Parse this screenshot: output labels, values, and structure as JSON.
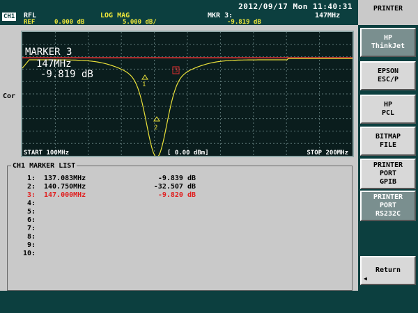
{
  "header": {
    "datetime": "2012/09/17 Mon 11:40:31",
    "channel": "CH1",
    "format": "RFL",
    "ref_label": "REF",
    "ref_value": "0.000 dB",
    "scale_type": "LOG MAG",
    "scale_value": "5.000 dB/",
    "marker_label": "MKR 3:",
    "marker_freq": "147MHz",
    "marker_value": "-9.819 dB",
    "cor": "Cor"
  },
  "plot": {
    "marker_title": "MARKER 3",
    "marker_freq": "147MHz",
    "marker_value": "-9.819 dB",
    "start_label": "START 100MHz",
    "ref_line_label": "[ 0.00 dBm]",
    "stop_label": "STOP 200MHz",
    "trace_color": "#e9e13a",
    "ref_color": "#e03030",
    "marker_labels": [
      "1",
      "2",
      "3"
    ]
  },
  "marker_list": {
    "title": "CH1 MARKER LIST",
    "rows": [
      {
        "idx": "1:",
        "freq": "137.083MHz",
        "amp": "-9.839 dB",
        "active": false
      },
      {
        "idx": "2:",
        "freq": "140.750MHz",
        "amp": "-32.507 dB",
        "active": false
      },
      {
        "idx": "3:",
        "freq": "147.000MHz",
        "amp": "-9.820 dB",
        "active": true
      },
      {
        "idx": "4:",
        "freq": "",
        "amp": "",
        "active": false
      },
      {
        "idx": "5:",
        "freq": "",
        "amp": "",
        "active": false
      },
      {
        "idx": "6:",
        "freq": "",
        "amp": "",
        "active": false
      },
      {
        "idx": "7:",
        "freq": "",
        "amp": "",
        "active": false
      },
      {
        "idx": "8:",
        "freq": "",
        "amp": "",
        "active": false
      },
      {
        "idx": "9:",
        "freq": "",
        "amp": "",
        "active": false
      },
      {
        "idx": "10:",
        "freq": "",
        "amp": "",
        "active": false
      }
    ]
  },
  "softkeys": {
    "title": "PRINTER",
    "items": [
      {
        "label": "HP\nThinkJet",
        "selected": true
      },
      {
        "label": "EPSON\nESC/P",
        "selected": false
      },
      {
        "label": "HP\nPCL",
        "selected": false
      },
      {
        "label": "BITMAP\nFILE",
        "selected": false
      },
      {
        "label": "PRINTER\nPORT\nGPIB",
        "selected": false
      },
      {
        "label": "PRINTER\nPORT\nRS232C",
        "selected": true
      },
      {
        "label": "Return",
        "selected": false
      }
    ]
  },
  "colors": {
    "header_white": "#ffffff",
    "header_yellow": "#f1e93a",
    "active_marker": "#e02020"
  }
}
